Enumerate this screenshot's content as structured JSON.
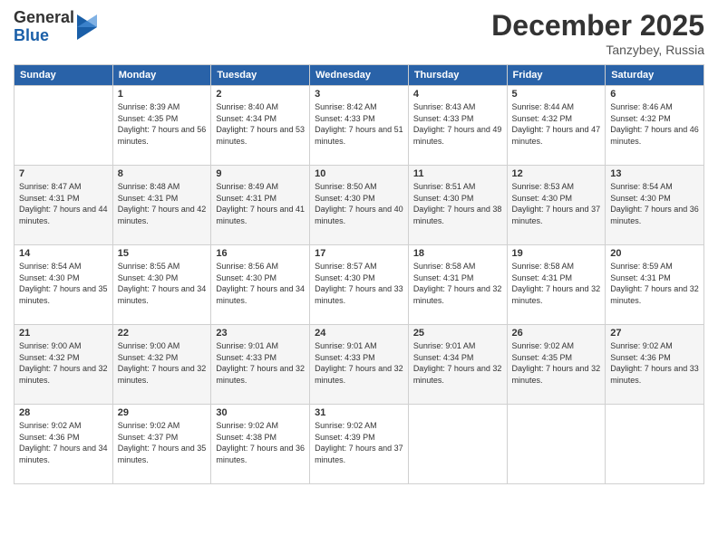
{
  "header": {
    "logo": {
      "general": "General",
      "blue": "Blue"
    },
    "title": "December 2025",
    "location": "Tanzybey, Russia"
  },
  "weekdays": [
    "Sunday",
    "Monday",
    "Tuesday",
    "Wednesday",
    "Thursday",
    "Friday",
    "Saturday"
  ],
  "weeks": [
    [
      {
        "day": "",
        "sunrise": "",
        "sunset": "",
        "daylight": ""
      },
      {
        "day": "1",
        "sunrise": "Sunrise: 8:39 AM",
        "sunset": "Sunset: 4:35 PM",
        "daylight": "Daylight: 7 hours and 56 minutes."
      },
      {
        "day": "2",
        "sunrise": "Sunrise: 8:40 AM",
        "sunset": "Sunset: 4:34 PM",
        "daylight": "Daylight: 7 hours and 53 minutes."
      },
      {
        "day": "3",
        "sunrise": "Sunrise: 8:42 AM",
        "sunset": "Sunset: 4:33 PM",
        "daylight": "Daylight: 7 hours and 51 minutes."
      },
      {
        "day": "4",
        "sunrise": "Sunrise: 8:43 AM",
        "sunset": "Sunset: 4:33 PM",
        "daylight": "Daylight: 7 hours and 49 minutes."
      },
      {
        "day": "5",
        "sunrise": "Sunrise: 8:44 AM",
        "sunset": "Sunset: 4:32 PM",
        "daylight": "Daylight: 7 hours and 47 minutes."
      },
      {
        "day": "6",
        "sunrise": "Sunrise: 8:46 AM",
        "sunset": "Sunset: 4:32 PM",
        "daylight": "Daylight: 7 hours and 46 minutes."
      }
    ],
    [
      {
        "day": "7",
        "sunrise": "Sunrise: 8:47 AM",
        "sunset": "Sunset: 4:31 PM",
        "daylight": "Daylight: 7 hours and 44 minutes."
      },
      {
        "day": "8",
        "sunrise": "Sunrise: 8:48 AM",
        "sunset": "Sunset: 4:31 PM",
        "daylight": "Daylight: 7 hours and 42 minutes."
      },
      {
        "day": "9",
        "sunrise": "Sunrise: 8:49 AM",
        "sunset": "Sunset: 4:31 PM",
        "daylight": "Daylight: 7 hours and 41 minutes."
      },
      {
        "day": "10",
        "sunrise": "Sunrise: 8:50 AM",
        "sunset": "Sunset: 4:30 PM",
        "daylight": "Daylight: 7 hours and 40 minutes."
      },
      {
        "day": "11",
        "sunrise": "Sunrise: 8:51 AM",
        "sunset": "Sunset: 4:30 PM",
        "daylight": "Daylight: 7 hours and 38 minutes."
      },
      {
        "day": "12",
        "sunrise": "Sunrise: 8:53 AM",
        "sunset": "Sunset: 4:30 PM",
        "daylight": "Daylight: 7 hours and 37 minutes."
      },
      {
        "day": "13",
        "sunrise": "Sunrise: 8:54 AM",
        "sunset": "Sunset: 4:30 PM",
        "daylight": "Daylight: 7 hours and 36 minutes."
      }
    ],
    [
      {
        "day": "14",
        "sunrise": "Sunrise: 8:54 AM",
        "sunset": "Sunset: 4:30 PM",
        "daylight": "Daylight: 7 hours and 35 minutes."
      },
      {
        "day": "15",
        "sunrise": "Sunrise: 8:55 AM",
        "sunset": "Sunset: 4:30 PM",
        "daylight": "Daylight: 7 hours and 34 minutes."
      },
      {
        "day": "16",
        "sunrise": "Sunrise: 8:56 AM",
        "sunset": "Sunset: 4:30 PM",
        "daylight": "Daylight: 7 hours and 34 minutes."
      },
      {
        "day": "17",
        "sunrise": "Sunrise: 8:57 AM",
        "sunset": "Sunset: 4:30 PM",
        "daylight": "Daylight: 7 hours and 33 minutes."
      },
      {
        "day": "18",
        "sunrise": "Sunrise: 8:58 AM",
        "sunset": "Sunset: 4:31 PM",
        "daylight": "Daylight: 7 hours and 32 minutes."
      },
      {
        "day": "19",
        "sunrise": "Sunrise: 8:58 AM",
        "sunset": "Sunset: 4:31 PM",
        "daylight": "Daylight: 7 hours and 32 minutes."
      },
      {
        "day": "20",
        "sunrise": "Sunrise: 8:59 AM",
        "sunset": "Sunset: 4:31 PM",
        "daylight": "Daylight: 7 hours and 32 minutes."
      }
    ],
    [
      {
        "day": "21",
        "sunrise": "Sunrise: 9:00 AM",
        "sunset": "Sunset: 4:32 PM",
        "daylight": "Daylight: 7 hours and 32 minutes."
      },
      {
        "day": "22",
        "sunrise": "Sunrise: 9:00 AM",
        "sunset": "Sunset: 4:32 PM",
        "daylight": "Daylight: 7 hours and 32 minutes."
      },
      {
        "day": "23",
        "sunrise": "Sunrise: 9:01 AM",
        "sunset": "Sunset: 4:33 PM",
        "daylight": "Daylight: 7 hours and 32 minutes."
      },
      {
        "day": "24",
        "sunrise": "Sunrise: 9:01 AM",
        "sunset": "Sunset: 4:33 PM",
        "daylight": "Daylight: 7 hours and 32 minutes."
      },
      {
        "day": "25",
        "sunrise": "Sunrise: 9:01 AM",
        "sunset": "Sunset: 4:34 PM",
        "daylight": "Daylight: 7 hours and 32 minutes."
      },
      {
        "day": "26",
        "sunrise": "Sunrise: 9:02 AM",
        "sunset": "Sunset: 4:35 PM",
        "daylight": "Daylight: 7 hours and 32 minutes."
      },
      {
        "day": "27",
        "sunrise": "Sunrise: 9:02 AM",
        "sunset": "Sunset: 4:36 PM",
        "daylight": "Daylight: 7 hours and 33 minutes."
      }
    ],
    [
      {
        "day": "28",
        "sunrise": "Sunrise: 9:02 AM",
        "sunset": "Sunset: 4:36 PM",
        "daylight": "Daylight: 7 hours and 34 minutes."
      },
      {
        "day": "29",
        "sunrise": "Sunrise: 9:02 AM",
        "sunset": "Sunset: 4:37 PM",
        "daylight": "Daylight: 7 hours and 35 minutes."
      },
      {
        "day": "30",
        "sunrise": "Sunrise: 9:02 AM",
        "sunset": "Sunset: 4:38 PM",
        "daylight": "Daylight: 7 hours and 36 minutes."
      },
      {
        "day": "31",
        "sunrise": "Sunrise: 9:02 AM",
        "sunset": "Sunset: 4:39 PM",
        "daylight": "Daylight: 7 hours and 37 minutes."
      },
      {
        "day": "",
        "sunrise": "",
        "sunset": "",
        "daylight": ""
      },
      {
        "day": "",
        "sunrise": "",
        "sunset": "",
        "daylight": ""
      },
      {
        "day": "",
        "sunrise": "",
        "sunset": "",
        "daylight": ""
      }
    ]
  ]
}
